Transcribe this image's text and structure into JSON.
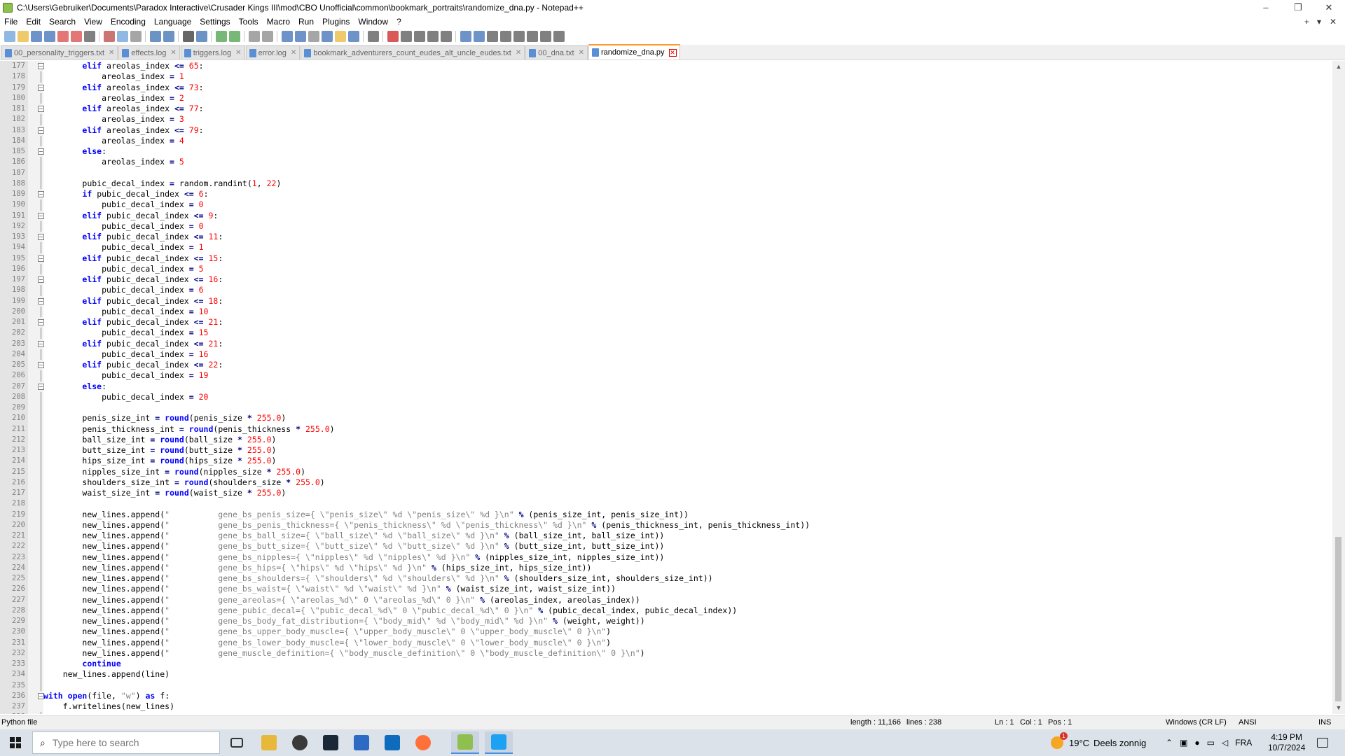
{
  "window": {
    "title": "C:\\Users\\Gebruiker\\Documents\\Paradox Interactive\\Crusader Kings III\\mod\\CBO Unofficial\\common\\bookmark_portraits\\randomize_dna.py - Notepad++",
    "minimize": "–",
    "maximize": "❐",
    "close": "✕"
  },
  "menu": {
    "items": [
      "File",
      "Edit",
      "Search",
      "View",
      "Encoding",
      "Language",
      "Settings",
      "Tools",
      "Macro",
      "Run",
      "Plugins",
      "Window",
      "?"
    ],
    "right_add": "+",
    "right_down": "▾",
    "right_close": "✕"
  },
  "toolbar": {
    "icons": [
      "new-file-icon",
      "open-file-icon",
      "save-icon",
      "save-all-icon",
      "close-icon",
      "close-all-icon",
      "print-icon",
      "cut-icon",
      "copy-icon",
      "paste-icon",
      "undo-icon",
      "redo-icon",
      "find-icon",
      "replace-icon",
      "zoom-in-icon",
      "zoom-out-icon",
      "sync-v-icon",
      "sync-h-icon",
      "wrap-icon",
      "show-all-chars-icon",
      "indent-guide-icon",
      "function-list-icon",
      "folder-workspace-icon",
      "doc-map-icon",
      "monitor-icon",
      "record-macro-icon",
      "stop-macro-icon",
      "play-macro-icon",
      "run-macro-multiple-icon",
      "save-macro-icon",
      "panel-icon",
      "doc-list-icon",
      "eye-icon",
      "sort-icon",
      "up-icon",
      "down-icon",
      "lines-icon",
      "column-icon"
    ]
  },
  "tabs": [
    {
      "label": "00_personality_triggers.txt",
      "active": false
    },
    {
      "label": "effects.log",
      "active": false
    },
    {
      "label": "triggers.log",
      "active": false
    },
    {
      "label": "error.log",
      "active": false
    },
    {
      "label": "bookmark_adventurers_count_eudes_alt_uncle_eudes.txt",
      "active": false
    },
    {
      "label": "00_dna.txt",
      "active": false
    },
    {
      "label": "randomize_dna.py",
      "active": true
    }
  ],
  "tab_close_glyph": "✕",
  "editor": {
    "lines": [
      {
        "n": "177",
        "fold": true,
        "code": "        elif areolas_index <= 65:"
      },
      {
        "n": "178",
        "fold": false,
        "code": "            areolas_index = 1"
      },
      {
        "n": "179",
        "fold": true,
        "code": "        elif areolas_index <= 73:"
      },
      {
        "n": "180",
        "fold": false,
        "code": "            areolas_index = 2"
      },
      {
        "n": "181",
        "fold": true,
        "code": "        elif areolas_index <= 77:"
      },
      {
        "n": "182",
        "fold": false,
        "code": "            areolas_index = 3"
      },
      {
        "n": "183",
        "fold": true,
        "code": "        elif areolas_index <= 79:"
      },
      {
        "n": "184",
        "fold": false,
        "code": "            areolas_index = 4"
      },
      {
        "n": "185",
        "fold": true,
        "code": "        else:"
      },
      {
        "n": "186",
        "fold": false,
        "code": "            areolas_index = 5"
      },
      {
        "n": "187",
        "fold": false,
        "code": ""
      },
      {
        "n": "188",
        "fold": false,
        "code": "        pubic_decal_index = random.randint(1, 22)"
      },
      {
        "n": "189",
        "fold": true,
        "code": "        if pubic_decal_index <= 6:"
      },
      {
        "n": "190",
        "fold": false,
        "code": "            pubic_decal_index = 0"
      },
      {
        "n": "191",
        "fold": true,
        "code": "        elif pubic_decal_index <= 9:"
      },
      {
        "n": "192",
        "fold": false,
        "code": "            pubic_decal_index = 0"
      },
      {
        "n": "193",
        "fold": true,
        "code": "        elif pubic_decal_index <= 11:"
      },
      {
        "n": "194",
        "fold": false,
        "code": "            pubic_decal_index = 1"
      },
      {
        "n": "195",
        "fold": true,
        "code": "        elif pubic_decal_index <= 15:"
      },
      {
        "n": "196",
        "fold": false,
        "code": "            pubic_decal_index = 5"
      },
      {
        "n": "197",
        "fold": true,
        "code": "        elif pubic_decal_index <= 16:"
      },
      {
        "n": "198",
        "fold": false,
        "code": "            pubic_decal_index = 6"
      },
      {
        "n": "199",
        "fold": true,
        "code": "        elif pubic_decal_index <= 18:"
      },
      {
        "n": "200",
        "fold": false,
        "code": "            pubic_decal_index = 10"
      },
      {
        "n": "201",
        "fold": true,
        "code": "        elif pubic_decal_index <= 21:"
      },
      {
        "n": "202",
        "fold": false,
        "code": "            pubic_decal_index = 15"
      },
      {
        "n": "203",
        "fold": true,
        "code": "        elif pubic_decal_index <= 21:"
      },
      {
        "n": "204",
        "fold": false,
        "code": "            pubic_decal_index = 16"
      },
      {
        "n": "205",
        "fold": true,
        "code": "        elif pubic_decal_index <= 22:"
      },
      {
        "n": "206",
        "fold": false,
        "code": "            pubic_decal_index = 19"
      },
      {
        "n": "207",
        "fold": true,
        "code": "        else:"
      },
      {
        "n": "208",
        "fold": false,
        "code": "            pubic_decal_index = 20"
      },
      {
        "n": "209",
        "fold": false,
        "code": ""
      },
      {
        "n": "210",
        "fold": false,
        "code": "        penis_size_int = round(penis_size * 255.0)"
      },
      {
        "n": "211",
        "fold": false,
        "code": "        penis_thickness_int = round(penis_thickness * 255.0)"
      },
      {
        "n": "212",
        "fold": false,
        "code": "        ball_size_int = round(ball_size * 255.0)"
      },
      {
        "n": "213",
        "fold": false,
        "code": "        butt_size_int = round(butt_size * 255.0)"
      },
      {
        "n": "214",
        "fold": false,
        "code": "        hips_size_int = round(hips_size * 255.0)"
      },
      {
        "n": "215",
        "fold": false,
        "code": "        nipples_size_int = round(nipples_size * 255.0)"
      },
      {
        "n": "216",
        "fold": false,
        "code": "        shoulders_size_int = round(shoulders_size * 255.0)"
      },
      {
        "n": "217",
        "fold": false,
        "code": "        waist_size_int = round(waist_size * 255.0)"
      },
      {
        "n": "218",
        "fold": false,
        "code": ""
      },
      {
        "n": "219",
        "fold": false,
        "code": "        new_lines.append(\"          gene_bs_penis_size={ \\\"penis_size\\\" %d \\\"penis_size\\\" %d }\\n\" % (penis_size_int, penis_size_int))"
      },
      {
        "n": "220",
        "fold": false,
        "code": "        new_lines.append(\"          gene_bs_penis_thickness={ \\\"penis_thickness\\\" %d \\\"penis_thickness\\\" %d }\\n\" % (penis_thickness_int, penis_thickness_int))"
      },
      {
        "n": "221",
        "fold": false,
        "code": "        new_lines.append(\"          gene_bs_ball_size={ \\\"ball_size\\\" %d \\\"ball_size\\\" %d }\\n\" % (ball_size_int, ball_size_int))"
      },
      {
        "n": "222",
        "fold": false,
        "code": "        new_lines.append(\"          gene_bs_butt_size={ \\\"butt_size\\\" %d \\\"butt_size\\\" %d }\\n\" % (butt_size_int, butt_size_int))"
      },
      {
        "n": "223",
        "fold": false,
        "code": "        new_lines.append(\"          gene_bs_nipples={ \\\"nipples\\\" %d \\\"nipples\\\" %d }\\n\" % (nipples_size_int, nipples_size_int))"
      },
      {
        "n": "224",
        "fold": false,
        "code": "        new_lines.append(\"          gene_bs_hips={ \\\"hips\\\" %d \\\"hips\\\" %d }\\n\" % (hips_size_int, hips_size_int))"
      },
      {
        "n": "225",
        "fold": false,
        "code": "        new_lines.append(\"          gene_bs_shoulders={ \\\"shoulders\\\" %d \\\"shoulders\\\" %d }\\n\" % (shoulders_size_int, shoulders_size_int))"
      },
      {
        "n": "226",
        "fold": false,
        "code": "        new_lines.append(\"          gene_bs_waist={ \\\"waist\\\" %d \\\"waist\\\" %d }\\n\" % (waist_size_int, waist_size_int))"
      },
      {
        "n": "227",
        "fold": false,
        "code": "        new_lines.append(\"          gene_areolas={ \\\"areolas_%d\\\" 0 \\\"areolas_%d\\\" 0 }\\n\" % (areolas_index, areolas_index))"
      },
      {
        "n": "228",
        "fold": false,
        "code": "        new_lines.append(\"          gene_pubic_decal={ \\\"pubic_decal_%d\\\" 0 \\\"pubic_decal_%d\\\" 0 }\\n\" % (pubic_decal_index, pubic_decal_index))"
      },
      {
        "n": "229",
        "fold": false,
        "code": "        new_lines.append(\"          gene_bs_body_fat_distribution={ \\\"body_mid\\\" %d \\\"body_mid\\\" %d }\\n\" % (weight, weight))"
      },
      {
        "n": "230",
        "fold": false,
        "code": "        new_lines.append(\"          gene_bs_upper_body_muscle={ \\\"upper_body_muscle\\\" 0 \\\"upper_body_muscle\\\" 0 }\\n\")"
      },
      {
        "n": "231",
        "fold": false,
        "code": "        new_lines.append(\"          gene_bs_lower_body_muscle={ \\\"lower_body_muscle\\\" 0 \\\"lower_body_muscle\\\" 0 }\\n\")"
      },
      {
        "n": "232",
        "fold": false,
        "code": "        new_lines.append(\"          gene_muscle_definition={ \\\"body_muscle_definition\\\" 0 \\\"body_muscle_definition\\\" 0 }\\n\")"
      },
      {
        "n": "233",
        "fold": false,
        "code": "        continue"
      },
      {
        "n": "234",
        "fold": false,
        "code": "    new_lines.append(line)"
      },
      {
        "n": "235",
        "fold": false,
        "code": ""
      },
      {
        "n": "236",
        "fold": true,
        "code": "with open(file, \"w\") as f:"
      },
      {
        "n": "237",
        "fold": false,
        "code": "    f.writelines(new_lines)"
      },
      {
        "n": "238",
        "fold": false,
        "code": ""
      }
    ]
  },
  "scrollbar": {
    "up": "▲",
    "down": "▼"
  },
  "status": {
    "language": "Python file",
    "length": "length : 11,166",
    "lines": "lines : 238",
    "ln": "Ln : 1",
    "col": "Col : 1",
    "pos": "Pos : 1",
    "eol": "Windows (CR LF)",
    "encoding": "ANSI",
    "mode": "INS"
  },
  "taskbar": {
    "search_placeholder": "Type here to search",
    "weather_temp": "19°C",
    "weather_text": "Deels zonnig",
    "weather_badge": "1",
    "lang": "FRA",
    "time": "4:19 PM",
    "date": "10/7/2024",
    "apps": [
      "task-view-icon",
      "file-explorer-icon",
      "obs-icon",
      "steam-icon",
      "calculator-icon",
      "outlook-icon",
      "firefox-icon",
      "notepadpp-icon",
      "paradox-launcher-icon"
    ]
  }
}
